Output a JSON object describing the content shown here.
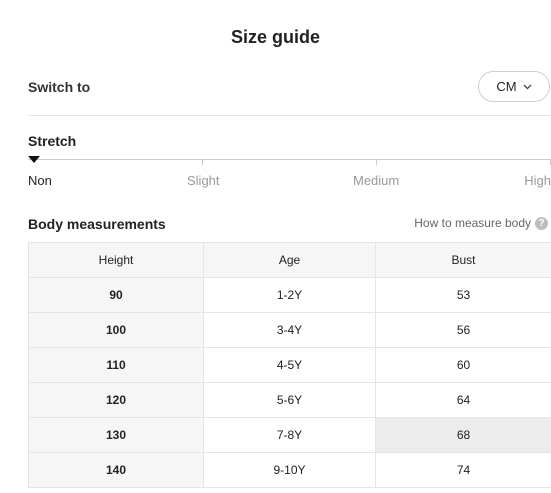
{
  "title": "Size guide",
  "switch": {
    "label": "Switch to",
    "unit": "CM"
  },
  "stretch": {
    "label": "Stretch",
    "levels": [
      "Non",
      "Slight",
      "Medium",
      "High"
    ],
    "selected": "Non"
  },
  "body": {
    "title": "Body measurements",
    "link": "How to measure body",
    "help_icon": "?"
  },
  "table": {
    "headers": [
      "Height",
      "Age",
      "Bust"
    ],
    "rows": [
      [
        "90",
        "1-2Y",
        "53"
      ],
      [
        "100",
        "3-4Y",
        "56"
      ],
      [
        "110",
        "4-5Y",
        "60"
      ],
      [
        "120",
        "5-6Y",
        "64"
      ],
      [
        "130",
        "7-8Y",
        "68"
      ],
      [
        "140",
        "9-10Y",
        "74"
      ]
    ]
  },
  "colors": {
    "accent": "#111111",
    "header_bg": "#f6f6f6",
    "highlight_bg": "#ececec",
    "border": "#e5e5e5"
  }
}
